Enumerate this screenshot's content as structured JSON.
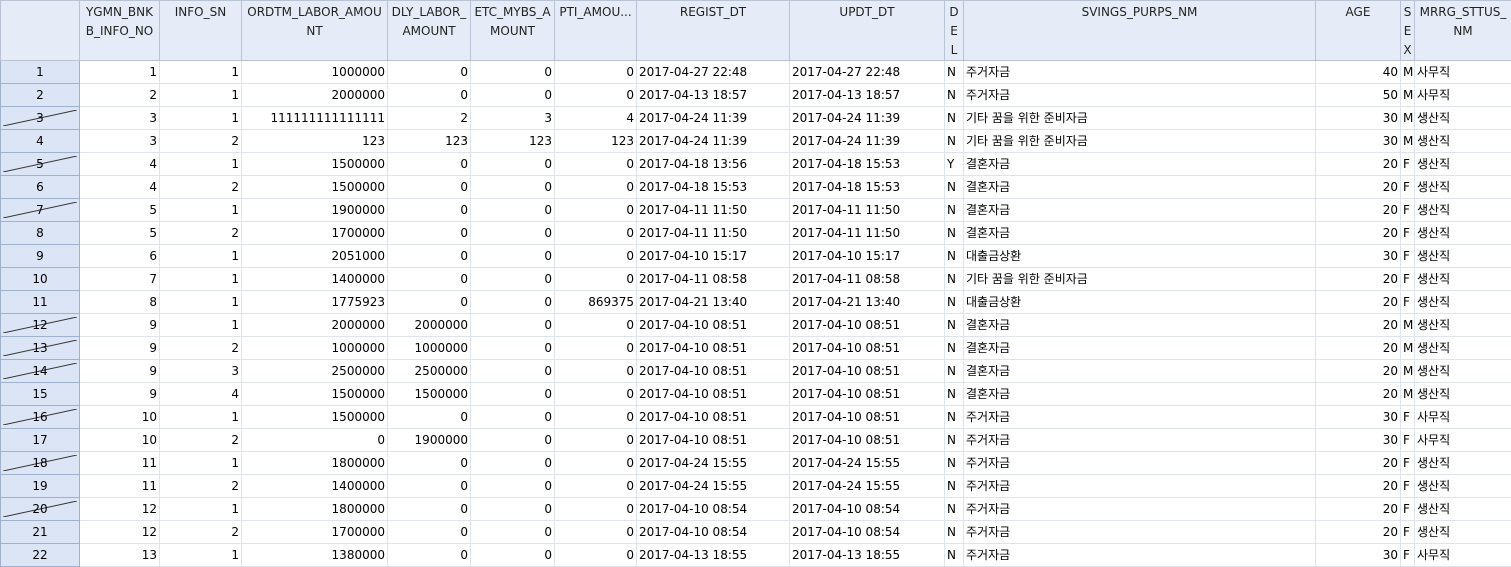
{
  "columns": [
    {
      "key": "row",
      "label": ""
    },
    {
      "key": "ygmn",
      "label": "YGMN_BNKB_INFO_NO"
    },
    {
      "key": "info_sn",
      "label": "INFO_SN"
    },
    {
      "key": "ordtm",
      "label": "ORDTM_LABOR_AMOUNT"
    },
    {
      "key": "dly",
      "label": "DLY_LABOR_AMOUNT"
    },
    {
      "key": "etc",
      "label": "ETC_MYBS_AMOUNT"
    },
    {
      "key": "pti",
      "label": "PTI_AMOU..."
    },
    {
      "key": "regist",
      "label": "REGIST_DT"
    },
    {
      "key": "updt",
      "label": "UPDT_DT"
    },
    {
      "key": "del",
      "label": "DEL"
    },
    {
      "key": "purps",
      "label": "SVINGS_PURPS_NM"
    },
    {
      "key": "age",
      "label": "AGE"
    },
    {
      "key": "sex",
      "label": "SEX"
    },
    {
      "key": "mrrg",
      "label": "MRRG_STTUS_NM"
    }
  ],
  "rows": [
    {
      "row": "1",
      "struck": false,
      "ygmn": "1",
      "info_sn": "1",
      "ordtm": "1000000",
      "dly": "0",
      "etc": "0",
      "pti": "0",
      "regist": "2017-04-27 22:48",
      "updt": "2017-04-27 22:48",
      "del": "N",
      "purps": "주거자금",
      "age": "40",
      "sex": "M",
      "mrrg": "사무직"
    },
    {
      "row": "2",
      "struck": false,
      "ygmn": "2",
      "info_sn": "1",
      "ordtm": "2000000",
      "dly": "0",
      "etc": "0",
      "pti": "0",
      "regist": "2017-04-13 18:57",
      "updt": "2017-04-13 18:57",
      "del": "N",
      "purps": "주거자금",
      "age": "50",
      "sex": "M",
      "mrrg": "사무직"
    },
    {
      "row": "3",
      "struck": true,
      "ygmn": "3",
      "info_sn": "1",
      "ordtm": "111111111111111",
      "dly": "2",
      "etc": "3",
      "pti": "4",
      "regist": "2017-04-24 11:39",
      "updt": "2017-04-24 11:39",
      "del": "N",
      "purps": "기타 꿈을 위한 준비자금",
      "age": "30",
      "sex": "M",
      "mrrg": "생산직"
    },
    {
      "row": "4",
      "struck": false,
      "ygmn": "3",
      "info_sn": "2",
      "ordtm": "123",
      "dly": "123",
      "etc": "123",
      "pti": "123",
      "regist": "2017-04-24 11:39",
      "updt": "2017-04-24 11:39",
      "del": "N",
      "purps": "기타 꿈을 위한 준비자금",
      "age": "30",
      "sex": "M",
      "mrrg": "생산직"
    },
    {
      "row": "5",
      "struck": true,
      "ygmn": "4",
      "info_sn": "1",
      "ordtm": "1500000",
      "dly": "0",
      "etc": "0",
      "pti": "0",
      "regist": "2017-04-18 13:56",
      "updt": "2017-04-18 15:53",
      "del": "Y",
      "purps": "결혼자금",
      "age": "20",
      "sex": "F",
      "mrrg": "생산직"
    },
    {
      "row": "6",
      "struck": false,
      "ygmn": "4",
      "info_sn": "2",
      "ordtm": "1500000",
      "dly": "0",
      "etc": "0",
      "pti": "0",
      "regist": "2017-04-18 15:53",
      "updt": "2017-04-18 15:53",
      "del": "N",
      "purps": "결혼자금",
      "age": "20",
      "sex": "F",
      "mrrg": "생산직"
    },
    {
      "row": "7",
      "struck": true,
      "ygmn": "5",
      "info_sn": "1",
      "ordtm": "1900000",
      "dly": "0",
      "etc": "0",
      "pti": "0",
      "regist": "2017-04-11 11:50",
      "updt": "2017-04-11 11:50",
      "del": "N",
      "purps": "결혼자금",
      "age": "20",
      "sex": "F",
      "mrrg": "생산직"
    },
    {
      "row": "8",
      "struck": false,
      "ygmn": "5",
      "info_sn": "2",
      "ordtm": "1700000",
      "dly": "0",
      "etc": "0",
      "pti": "0",
      "regist": "2017-04-11 11:50",
      "updt": "2017-04-11 11:50",
      "del": "N",
      "purps": "결혼자금",
      "age": "20",
      "sex": "F",
      "mrrg": "생산직"
    },
    {
      "row": "9",
      "struck": false,
      "ygmn": "6",
      "info_sn": "1",
      "ordtm": "2051000",
      "dly": "0",
      "etc": "0",
      "pti": "0",
      "regist": "2017-04-10 15:17",
      "updt": "2017-04-10 15:17",
      "del": "N",
      "purps": "대출금상환",
      "age": "30",
      "sex": "F",
      "mrrg": "생산직"
    },
    {
      "row": "10",
      "struck": false,
      "ygmn": "7",
      "info_sn": "1",
      "ordtm": "1400000",
      "dly": "0",
      "etc": "0",
      "pti": "0",
      "regist": "2017-04-11 08:58",
      "updt": "2017-04-11 08:58",
      "del": "N",
      "purps": "기타 꿈을 위한 준비자금",
      "age": "20",
      "sex": "F",
      "mrrg": "생산직"
    },
    {
      "row": "11",
      "struck": false,
      "ygmn": "8",
      "info_sn": "1",
      "ordtm": "1775923",
      "dly": "0",
      "etc": "0",
      "pti": "869375",
      "regist": "2017-04-21 13:40",
      "updt": "2017-04-21 13:40",
      "del": "N",
      "purps": "대출금상환",
      "age": "20",
      "sex": "F",
      "mrrg": "생산직"
    },
    {
      "row": "12",
      "struck": true,
      "ygmn": "9",
      "info_sn": "1",
      "ordtm": "2000000",
      "dly": "2000000",
      "etc": "0",
      "pti": "0",
      "regist": "2017-04-10 08:51",
      "updt": "2017-04-10 08:51",
      "del": "N",
      "purps": "결혼자금",
      "age": "20",
      "sex": "M",
      "mrrg": "생산직"
    },
    {
      "row": "13",
      "struck": true,
      "ygmn": "9",
      "info_sn": "2",
      "ordtm": "1000000",
      "dly": "1000000",
      "etc": "0",
      "pti": "0",
      "regist": "2017-04-10 08:51",
      "updt": "2017-04-10 08:51",
      "del": "N",
      "purps": "결혼자금",
      "age": "20",
      "sex": "M",
      "mrrg": "생산직"
    },
    {
      "row": "14",
      "struck": true,
      "ygmn": "9",
      "info_sn": "3",
      "ordtm": "2500000",
      "dly": "2500000",
      "etc": "0",
      "pti": "0",
      "regist": "2017-04-10 08:51",
      "updt": "2017-04-10 08:51",
      "del": "N",
      "purps": "결혼자금",
      "age": "20",
      "sex": "M",
      "mrrg": "생산직"
    },
    {
      "row": "15",
      "struck": false,
      "ygmn": "9",
      "info_sn": "4",
      "ordtm": "1500000",
      "dly": "1500000",
      "etc": "0",
      "pti": "0",
      "regist": "2017-04-10 08:51",
      "updt": "2017-04-10 08:51",
      "del": "N",
      "purps": "결혼자금",
      "age": "20",
      "sex": "M",
      "mrrg": "생산직"
    },
    {
      "row": "16",
      "struck": true,
      "ygmn": "10",
      "info_sn": "1",
      "ordtm": "1500000",
      "dly": "0",
      "etc": "0",
      "pti": "0",
      "regist": "2017-04-10 08:51",
      "updt": "2017-04-10 08:51",
      "del": "N",
      "purps": "주거자금",
      "age": "30",
      "sex": "F",
      "mrrg": "사무직"
    },
    {
      "row": "17",
      "struck": false,
      "ygmn": "10",
      "info_sn": "2",
      "ordtm": "0",
      "dly": "1900000",
      "etc": "0",
      "pti": "0",
      "regist": "2017-04-10 08:51",
      "updt": "2017-04-10 08:51",
      "del": "N",
      "purps": "주거자금",
      "age": "30",
      "sex": "F",
      "mrrg": "사무직"
    },
    {
      "row": "18",
      "struck": true,
      "ygmn": "11",
      "info_sn": "1",
      "ordtm": "1800000",
      "dly": "0",
      "etc": "0",
      "pti": "0",
      "regist": "2017-04-24 15:55",
      "updt": "2017-04-24 15:55",
      "del": "N",
      "purps": "주거자금",
      "age": "20",
      "sex": "F",
      "mrrg": "생산직"
    },
    {
      "row": "19",
      "struck": false,
      "ygmn": "11",
      "info_sn": "2",
      "ordtm": "1400000",
      "dly": "0",
      "etc": "0",
      "pti": "0",
      "regist": "2017-04-24 15:55",
      "updt": "2017-04-24 15:55",
      "del": "N",
      "purps": "주거자금",
      "age": "20",
      "sex": "F",
      "mrrg": "생산직"
    },
    {
      "row": "20",
      "struck": true,
      "ygmn": "12",
      "info_sn": "1",
      "ordtm": "1800000",
      "dly": "0",
      "etc": "0",
      "pti": "0",
      "regist": "2017-04-10 08:54",
      "updt": "2017-04-10 08:54",
      "del": "N",
      "purps": "주거자금",
      "age": "20",
      "sex": "F",
      "mrrg": "생산직"
    },
    {
      "row": "21",
      "struck": false,
      "ygmn": "12",
      "info_sn": "2",
      "ordtm": "1700000",
      "dly": "0",
      "etc": "0",
      "pti": "0",
      "regist": "2017-04-10 08:54",
      "updt": "2017-04-10 08:54",
      "del": "N",
      "purps": "주거자금",
      "age": "20",
      "sex": "F",
      "mrrg": "생산직"
    },
    {
      "row": "22",
      "struck": false,
      "ygmn": "13",
      "info_sn": "1",
      "ordtm": "1380000",
      "dly": "0",
      "etc": "0",
      "pti": "0",
      "regist": "2017-04-13 18:55",
      "updt": "2017-04-13 18:55",
      "del": "N",
      "purps": "주거자금",
      "age": "30",
      "sex": "F",
      "mrrg": "사무직"
    }
  ]
}
